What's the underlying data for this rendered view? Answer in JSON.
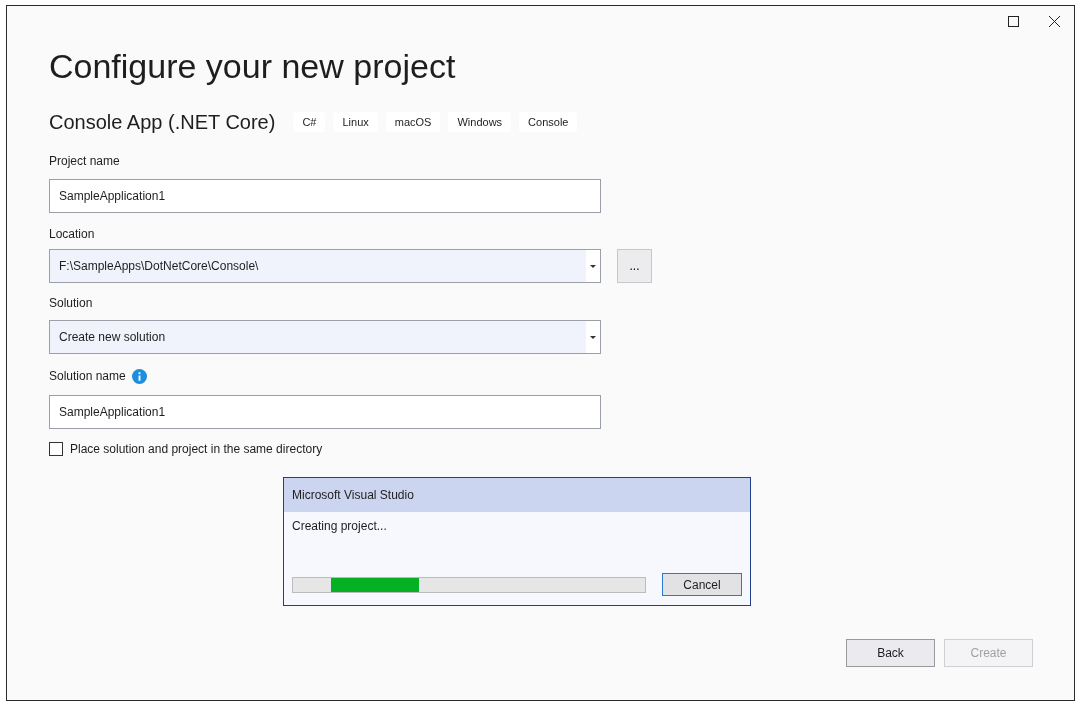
{
  "title": "Configure your new project",
  "template": {
    "name": "Console App (.NET Core)",
    "tags": [
      "C#",
      "Linux",
      "macOS",
      "Windows",
      "Console"
    ]
  },
  "fields": [
    {
      "kind": "text",
      "label": "Project name",
      "value": "SampleApplication1"
    },
    {
      "kind": "dropdown",
      "label": "Location",
      "value": "F:\\SampleApps\\DotNetCore\\Console\\",
      "browse": "..."
    },
    {
      "kind": "dropdown",
      "label": "Solution",
      "value": "Create new solution"
    },
    {
      "kind": "text",
      "label": "Solution name",
      "value": "SampleApplication1",
      "info": true
    }
  ],
  "checkbox": {
    "label": "Place solution and project in the same directory",
    "checked": false
  },
  "dialog": {
    "title": "Microsoft Visual Studio",
    "message": "Creating project...",
    "button": "Cancel"
  },
  "buttons": [
    {
      "label": "Back",
      "disabled": false
    },
    {
      "label": "Create",
      "disabled": true
    }
  ]
}
